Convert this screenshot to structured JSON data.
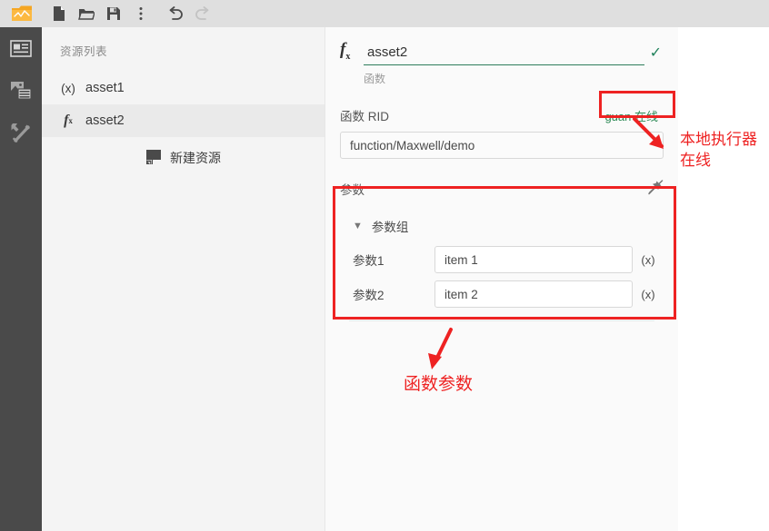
{
  "toolbar": {
    "items": [
      {
        "name": "app-logo-icon",
        "label": "Maxwell"
      },
      {
        "name": "new-file-icon",
        "label": "新建"
      },
      {
        "name": "open-folder-icon",
        "label": "打开"
      },
      {
        "name": "save-icon",
        "label": "保存"
      },
      {
        "name": "more-vertical-icon",
        "label": "更多"
      },
      {
        "name": "undo-icon",
        "label": "撤销"
      },
      {
        "name": "redo-icon",
        "label": "重做"
      }
    ]
  },
  "rail": {
    "items": [
      {
        "name": "sidebar-item-layout",
        "icon": "layout-panel-icon",
        "selected": true
      },
      {
        "name": "sidebar-item-media",
        "icon": "media-stack-icon",
        "selected": false
      },
      {
        "name": "sidebar-item-tools",
        "icon": "tools-icon",
        "selected": false
      }
    ]
  },
  "resource_panel": {
    "title": "资源列表",
    "items": [
      {
        "icon": "variable-icon",
        "icon_text": "(x)",
        "label": "asset1",
        "active": false
      },
      {
        "icon": "function-icon",
        "icon_text": "fx",
        "label": "asset2",
        "active": true
      }
    ],
    "new_resource_label": "新建资源",
    "new_resource_icon": "new-resource-icon"
  },
  "editor": {
    "name_icon": "function-icon",
    "name_value": "asset2",
    "name_valid_icon": "check-icon",
    "name_caption": "函数",
    "rid_label": "函数 RID",
    "online_badge": "guan 在线",
    "rid_value": "function/Maxwell/demo",
    "params_label": "参数",
    "pin_icon": "pin-off-icon",
    "group": {
      "chevron_icon": "chevron-down-icon",
      "label": "参数组",
      "rows": [
        {
          "name": "参数1",
          "value": "item 1",
          "suffix": "(x)"
        },
        {
          "name": "参数2",
          "value": "item 2",
          "suffix": "(x)"
        }
      ]
    }
  },
  "annotations": {
    "executor_text": "本地执行器在线",
    "params_text": "函数参数",
    "color": "#ee2222"
  },
  "colors": {
    "toolbar_bg": "#dfdfdf",
    "rail_bg": "#4a4a4a",
    "resource_bg": "#f4f4f4",
    "editor_bg": "#fafafa",
    "online_green": "#2e8b57",
    "annotation_red": "#ee2222"
  }
}
